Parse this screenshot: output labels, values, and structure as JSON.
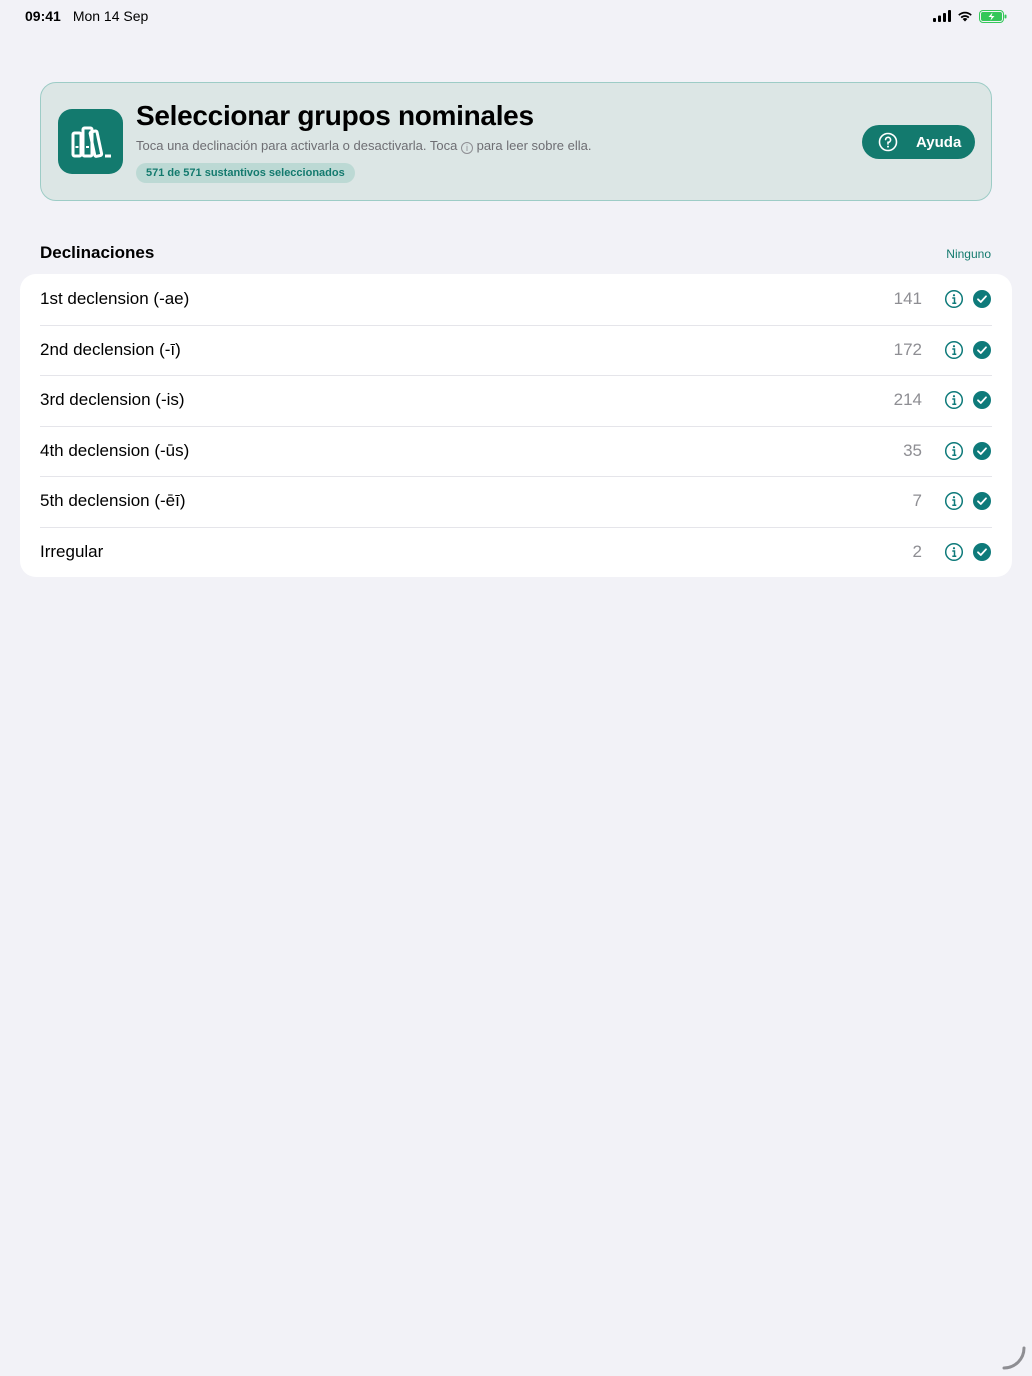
{
  "status_bar": {
    "time": "09:41",
    "date": "Mon 14 Sep"
  },
  "header": {
    "title": "Seleccionar grupos nominales",
    "subtitle_before": "Toca una declinación para activarla o desactivarla. Toca",
    "subtitle_info_glyph": "i",
    "subtitle_after": "para leer sobre ella.",
    "badge": "571 de 571 sustantivos seleccionados",
    "help_label": "Ayuda"
  },
  "section": {
    "title": "Declinaciones",
    "none_label": "Ninguno"
  },
  "declensions": [
    {
      "label": "1st declension (-ae)",
      "count": "141",
      "selected": true
    },
    {
      "label": "2nd declension (-ī)",
      "count": "172",
      "selected": true
    },
    {
      "label": "3rd declension (-is)",
      "count": "214",
      "selected": true
    },
    {
      "label": "4th declension (-ūs)",
      "count": "35",
      "selected": true
    },
    {
      "label": "5th declension (-ēī)",
      "count": "7",
      "selected": true
    },
    {
      "label": "Irregular",
      "count": "2",
      "selected": true
    }
  ],
  "colors": {
    "accent": "#137a6e",
    "check": "#0e7a7a",
    "background": "#f2f2f7",
    "header_bg": "#dce6e5"
  },
  "icons": {
    "app": "books-icon",
    "help": "question-circle-icon",
    "info": "info-circle-icon",
    "check": "checkmark-circle-icon"
  }
}
